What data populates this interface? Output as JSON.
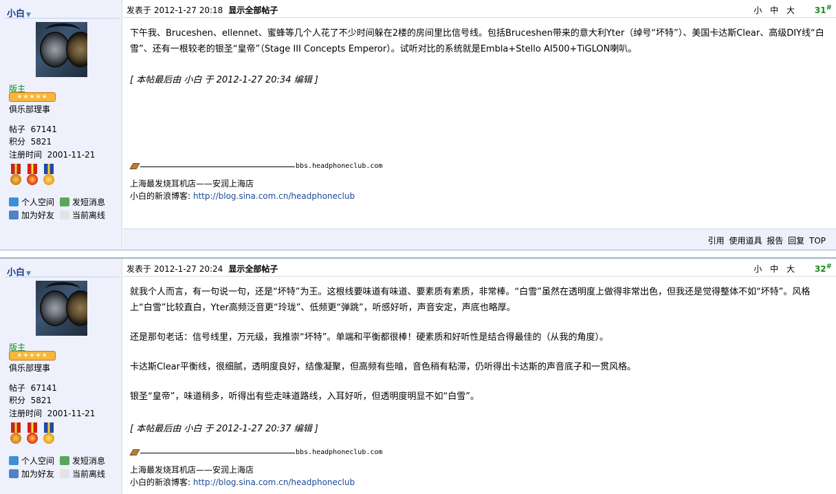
{
  "posts": [
    {
      "author": "小白",
      "rank_title": "版主",
      "group": "俱乐部理事",
      "posts_label": "帖子",
      "posts_count": "67141",
      "points_label": "积分",
      "points": "5821",
      "reg_label": "注册时间",
      "reg_date": "2001-11-21",
      "links": [
        "个人空间",
        "发短消息",
        "加为好友",
        "当前离线"
      ],
      "post_time": "发表于 2012-1-27 20:18",
      "show_all": "显示全部帖子",
      "font_sizes": [
        "小",
        "中",
        "大"
      ],
      "floor": "31",
      "floor_mark": "#",
      "paragraphs": [
        "下午我、Bruceshen、ellennet、蜜蜂等几个人花了不少时间躲在2楼的房间里比信号线。包括Bruceshen带来的意大利Yter（绰号“坏特”）、美国卡达斯Clear、高级DIY线“白雪”、还有一根较老的银圣“皇帝”（Stage III Concepts Emperor）。试听对比的系统就是Embla+Stello AI500+TiGLON喇叭。"
      ],
      "edited": "[ 本帖最后由 小白 于 2012-1-27 20:34 编辑 ]",
      "sig_site": "bbs.headphoneclub.com",
      "sig_line1": "上海最发烧耳机店——安润上海店",
      "sig_line2_label": "小白的新浪博客: ",
      "sig_line2_link": "http://blog.sina.com.cn/headphoneclub",
      "actions": [
        "引用",
        "使用道具",
        "报告",
        "回复",
        "TOP"
      ]
    },
    {
      "author": "小白",
      "rank_title": "版主",
      "group": "俱乐部理事",
      "posts_label": "帖子",
      "posts_count": "67141",
      "points_label": "积分",
      "points": "5821",
      "reg_label": "注册时间",
      "reg_date": "2001-11-21",
      "links": [
        "个人空间",
        "发短消息",
        "加为好友",
        "当前离线"
      ],
      "post_time": "发表于 2012-1-27 20:24",
      "show_all": "显示全部帖子",
      "font_sizes": [
        "小",
        "中",
        "大"
      ],
      "floor": "32",
      "floor_mark": "#",
      "paragraphs": [
        "就我个人而言，有一句说一句，还是“坏特”为王。这根线要味道有味道、要素质有素质，非常棒。“白雪”虽然在透明度上做得非常出色，但我还是觉得整体不如“坏特”。风格上“白雪”比较直白，Yter高频泛音更“玲珑”、低频更“弹跳”，听感好听，声音安定，声底也略厚。",
        "还是那句老话：信号线里，万元级，我推崇“坏特”。单端和平衡都很棒！硬素质和好听性是结合得最佳的（从我的角度）。",
        "卡达斯Clear平衡线，很细腻，透明度良好，结像凝聚，但高频有些暗，音色稍有粘滞，仍听得出卡达斯的声音底子和一贯风格。",
        "银圣“皇帝”，味道稍多，听得出有些走味道路线，入耳好听，但透明度明显不如“白雪”。"
      ],
      "edited": "[ 本帖最后由 小白 于 2012-1-27 20:37 编辑 ]",
      "sig_site": "bbs.headphoneclub.com",
      "sig_line1": "上海最发烧耳机店——安润上海店",
      "sig_line2_label": "小白的新浪博客: ",
      "sig_line2_link": "http://blog.sina.com.cn/headphoneclub"
    }
  ],
  "colors": {
    "sidebar_bg": "#eef0fb",
    "author_blue": "#0d3a84",
    "rank_green": "#0b8a1e",
    "floor_green": "#1a8a1a",
    "link_blue": "#1a4a96"
  },
  "icons": [
    "home-icon",
    "message-icon",
    "add-friend-icon",
    "offline-icon",
    "medal-icon",
    "pen-icon",
    "chevron-down-icon"
  ]
}
